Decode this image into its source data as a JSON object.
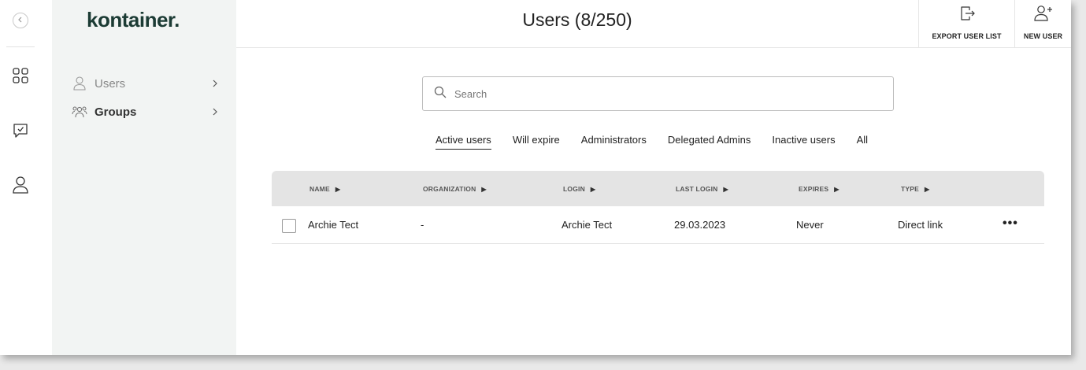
{
  "brand": {
    "logo_text": "kontainer."
  },
  "rail": {
    "icons": [
      "back-icon",
      "grid-icon",
      "chat-check-icon",
      "user-icon"
    ]
  },
  "sidebar": {
    "items": [
      {
        "label": "Users",
        "icon": "user-icon"
      },
      {
        "label": "Groups",
        "icon": "group-icon"
      }
    ]
  },
  "header": {
    "title": "Users (8/250)",
    "actions": [
      {
        "label": "EXPORT USER LIST",
        "icon": "export-icon"
      },
      {
        "label": "NEW USER",
        "icon": "add-user-icon"
      }
    ]
  },
  "search": {
    "placeholder": "Search",
    "value": ""
  },
  "tabs": [
    {
      "label": "Active users",
      "active": true
    },
    {
      "label": "Will expire",
      "active": false
    },
    {
      "label": "Administrators",
      "active": false
    },
    {
      "label": "Delegated Admins",
      "active": false
    },
    {
      "label": "Inactive users",
      "active": false
    },
    {
      "label": "All",
      "active": false
    }
  ],
  "table": {
    "columns": [
      "NAME",
      "ORGANIZATION",
      "LOGIN",
      "LAST LOGIN",
      "EXPIRES",
      "TYPE"
    ],
    "rows": [
      {
        "name": "Archie Tect",
        "organization": "-",
        "login": "Archie Tect",
        "last_login": "29.03.2023",
        "expires": "Never",
        "type": "Direct link",
        "actions": "•••"
      }
    ]
  },
  "colors": {
    "brand": "#1c3b34",
    "sidebar_bg": "#f2f4f3",
    "table_header_bg": "#e4e4e4"
  }
}
